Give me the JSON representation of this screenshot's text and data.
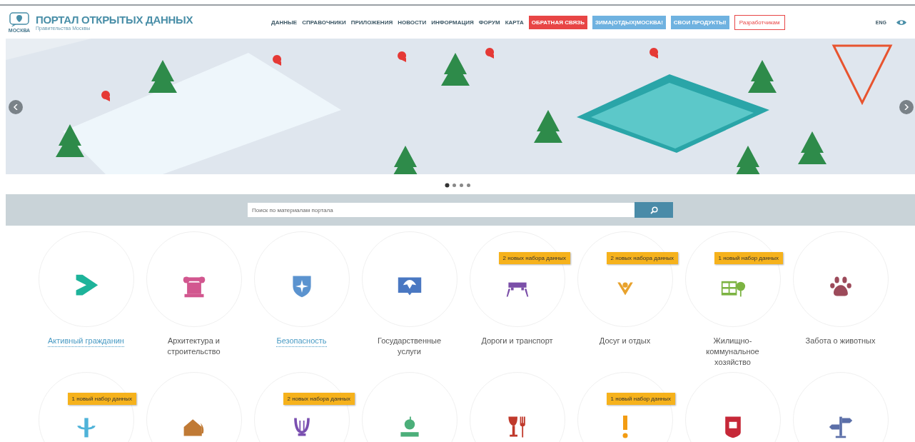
{
  "header": {
    "logo_caption": "МОСКВА",
    "title": "ПОРТАЛ ОТКРЫТЫХ ДАННЫХ",
    "subtitle": "Правительства Москвы",
    "nav": [
      {
        "label": "ДАННЫЕ",
        "kind": "link"
      },
      {
        "label": "СПРАВОЧНИКИ",
        "kind": "link"
      },
      {
        "label": "ПРИЛОЖЕНИЯ",
        "kind": "link"
      },
      {
        "label": "НОВОСТИ",
        "kind": "link"
      },
      {
        "label": "ИНФОРМАЦИЯ",
        "kind": "link"
      },
      {
        "label": "ФОРУМ",
        "kind": "link"
      },
      {
        "label": "КАРТА",
        "kind": "link"
      },
      {
        "label": "ОБРАТНАЯ СВЯЗЬ",
        "kind": "red"
      },
      {
        "label": "ЗИМА|ОТДЫХ|МОСКВА!",
        "kind": "blue"
      },
      {
        "label": "СВОИ ПРОДУКТЫ!",
        "kind": "blue"
      },
      {
        "label": "Разработчикам",
        "kind": "outline"
      }
    ],
    "language": "ENG"
  },
  "slider": {
    "dots": [
      {
        "selected": true
      },
      {
        "selected": false
      },
      {
        "selected": false
      },
      {
        "selected": false
      }
    ]
  },
  "search": {
    "placeholder": "Поиск по материалам портала"
  },
  "categories": [
    {
      "label": "Активный гражданин",
      "linked": true,
      "kind": "triangle",
      "color": "#1db39a"
    },
    {
      "label": "Архитектура и строительство",
      "linked": false,
      "kind": "column",
      "color": "#d2578f"
    },
    {
      "label": "Безопасность",
      "linked": true,
      "kind": "shield",
      "color": "#5b93cf"
    },
    {
      "label": "Государственные услуги",
      "linked": false,
      "kind": "emblem",
      "color": "#4a78c2"
    },
    {
      "label": "Дороги и транспорт",
      "linked": false,
      "kind": "car",
      "color": "#7b4fa8",
      "badge": "2 новых набора данных"
    },
    {
      "label": "Досуг и отдых",
      "linked": false,
      "kind": "people",
      "color": "#e8a22d",
      "badge": "2 новых набора данных"
    },
    {
      "label": "Жилищно-коммунальное хозяйство",
      "linked": false,
      "kind": "building",
      "color": "#7cb342",
      "badge": "1 новый набор данных"
    },
    {
      "label": "Забота о животных",
      "linked": false,
      "kind": "paw",
      "color": "#9c4a5a"
    },
    {
      "kind": "medicine",
      "color": "#4fb3d9",
      "badge": "1 новый набор данных"
    },
    {
      "kind": "house",
      "color": "#c07a35"
    },
    {
      "kind": "lyre",
      "color": "#7a4fb0",
      "badge": "2 новых набора данных"
    },
    {
      "kind": "apple",
      "color": "#4caf7a"
    },
    {
      "kind": "wine",
      "color": "#c0392b"
    },
    {
      "kind": "alert",
      "color": "#f39c12",
      "badge": "1 новый набор данных"
    },
    {
      "kind": "crest",
      "color": "#c62838"
    },
    {
      "kind": "signpost",
      "color": "#5b6fa8"
    }
  ]
}
